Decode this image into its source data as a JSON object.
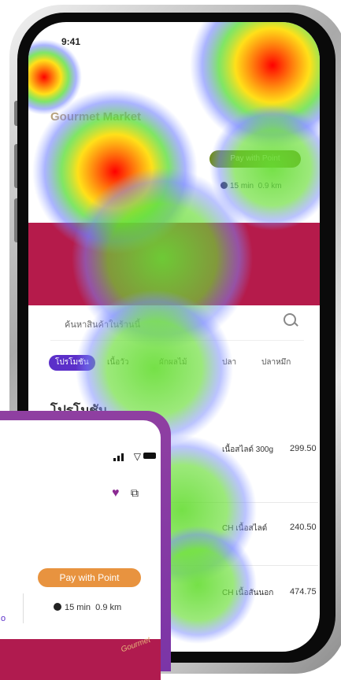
{
  "phone": {
    "status_time": "9:41",
    "store_title": "Gourmet Market",
    "pill_label": "Pay with Point",
    "eta": "15 min",
    "distance": "0.9 km",
    "search_placeholder": "ค้นหาสินค้าในร้านนี้",
    "tabs": [
      "โปรโมชัน",
      "เนื้อวัว",
      "ผักผลไม้",
      "ปลา",
      "ปลาหมึก"
    ],
    "section_title": "โปรโมชัน",
    "items": [
      {
        "name": "เนื้อสไลด์ 300g",
        "price": "299.50"
      },
      {
        "name": "CH เนื้อสไลด์",
        "price": "240.50"
      },
      {
        "name": "CH เนื้อสันนอก",
        "price": "474.75"
      }
    ]
  },
  "card": {
    "pay_label": "Pay with Point",
    "eta": "15 min",
    "distance": "0.9 km",
    "link_label": "o",
    "banner_text": "Gourmet"
  },
  "colors": {
    "accent": "#5b2fc9",
    "banner": "#b51b4b",
    "heart": "#8b2a92",
    "pay": "#e8933f",
    "frame": "#7b35a7"
  }
}
